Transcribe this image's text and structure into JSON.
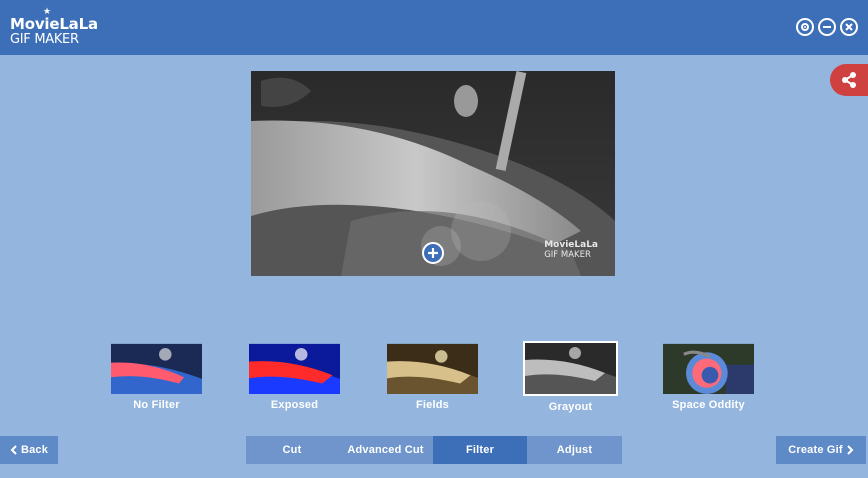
{
  "app": {
    "logo_line1": "MovieLaLa",
    "logo_line2": "GIF MAKER",
    "window_controls": [
      "settings-icon",
      "minimize-icon",
      "close-icon"
    ]
  },
  "preview": {
    "watermark_line1": "MovieLaLa",
    "watermark_line2": "GIF MAKER"
  },
  "filters": [
    {
      "label": "No Filter",
      "selected": false
    },
    {
      "label": "Exposed",
      "selected": false
    },
    {
      "label": "Fields",
      "selected": false
    },
    {
      "label": "Grayout",
      "selected": true
    },
    {
      "label": "Space Oddity",
      "selected": false
    }
  ],
  "nav": {
    "back_label": "Back",
    "create_label": "Create Gif"
  },
  "tabs": [
    {
      "label": "Cut",
      "active": false
    },
    {
      "label": "Advanced Cut",
      "active": false
    },
    {
      "label": "Filter",
      "active": true
    },
    {
      "label": "Adjust",
      "active": false
    }
  ],
  "colors": {
    "titlebar": "#3d6fb8",
    "background": "#94b6de",
    "share": "#cf4141",
    "active_tab": "#3d6fb8"
  }
}
